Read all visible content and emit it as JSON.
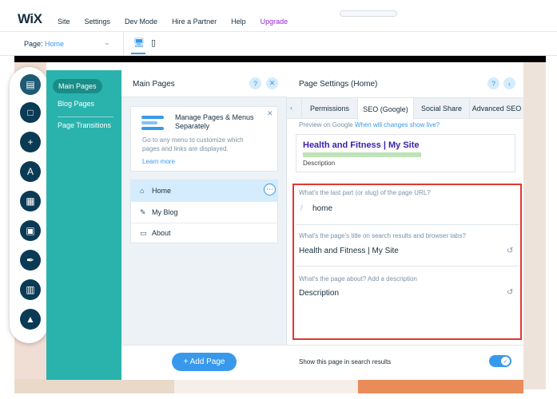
{
  "topbar": {
    "logo": "WiX",
    "menu": [
      "Site",
      "Settings",
      "Dev Mode",
      "Hire a Partner",
      "Help",
      "Upgrade"
    ]
  },
  "subbar": {
    "page_label": "Page:",
    "page_name": "Home"
  },
  "teal_panel": {
    "items": [
      "Main Pages",
      "Blog Pages",
      "Page Transitions"
    ]
  },
  "pages_panel": {
    "title": "Main Pages",
    "help": "?",
    "close": "✕",
    "tip": {
      "title": "Manage Pages & Menus Separately",
      "body": "Go to any menu to customize which pages and links are displayed.",
      "link": "Learn more",
      "close": "✕"
    },
    "pages": [
      "Home",
      "My Blog",
      "About"
    ],
    "more": "⋯",
    "add_button": "+ Add Page"
  },
  "settings_panel": {
    "title": "Page Settings (Home)",
    "help": "?",
    "back": "‹",
    "tab_prev": "‹",
    "tabs": [
      "Permissions",
      "SEO (Google)",
      "Social Share",
      "Advanced SEO"
    ],
    "preview_label": "Preview on Google",
    "preview_link": "When will changes show live?",
    "preview_title": "Health and Fitness | My Site",
    "preview_desc": "Description",
    "fields": [
      {
        "label": "What's the last part (or slug) of the page URL?",
        "value": "home"
      },
      {
        "label": "What's the page's title on search results and browser tabs?",
        "value": "Health and Fitness | My Site"
      },
      {
        "label": "What's the page about? Add a description",
        "value": "Description"
      }
    ],
    "search_toggle_label": "Show this page in search results",
    "search_toggle_on": true
  },
  "colors": {
    "accent": "#3899ec",
    "teal": "#2ab3ad",
    "highlight_border": "#e1372f",
    "upgrade": "#9a27d5"
  }
}
